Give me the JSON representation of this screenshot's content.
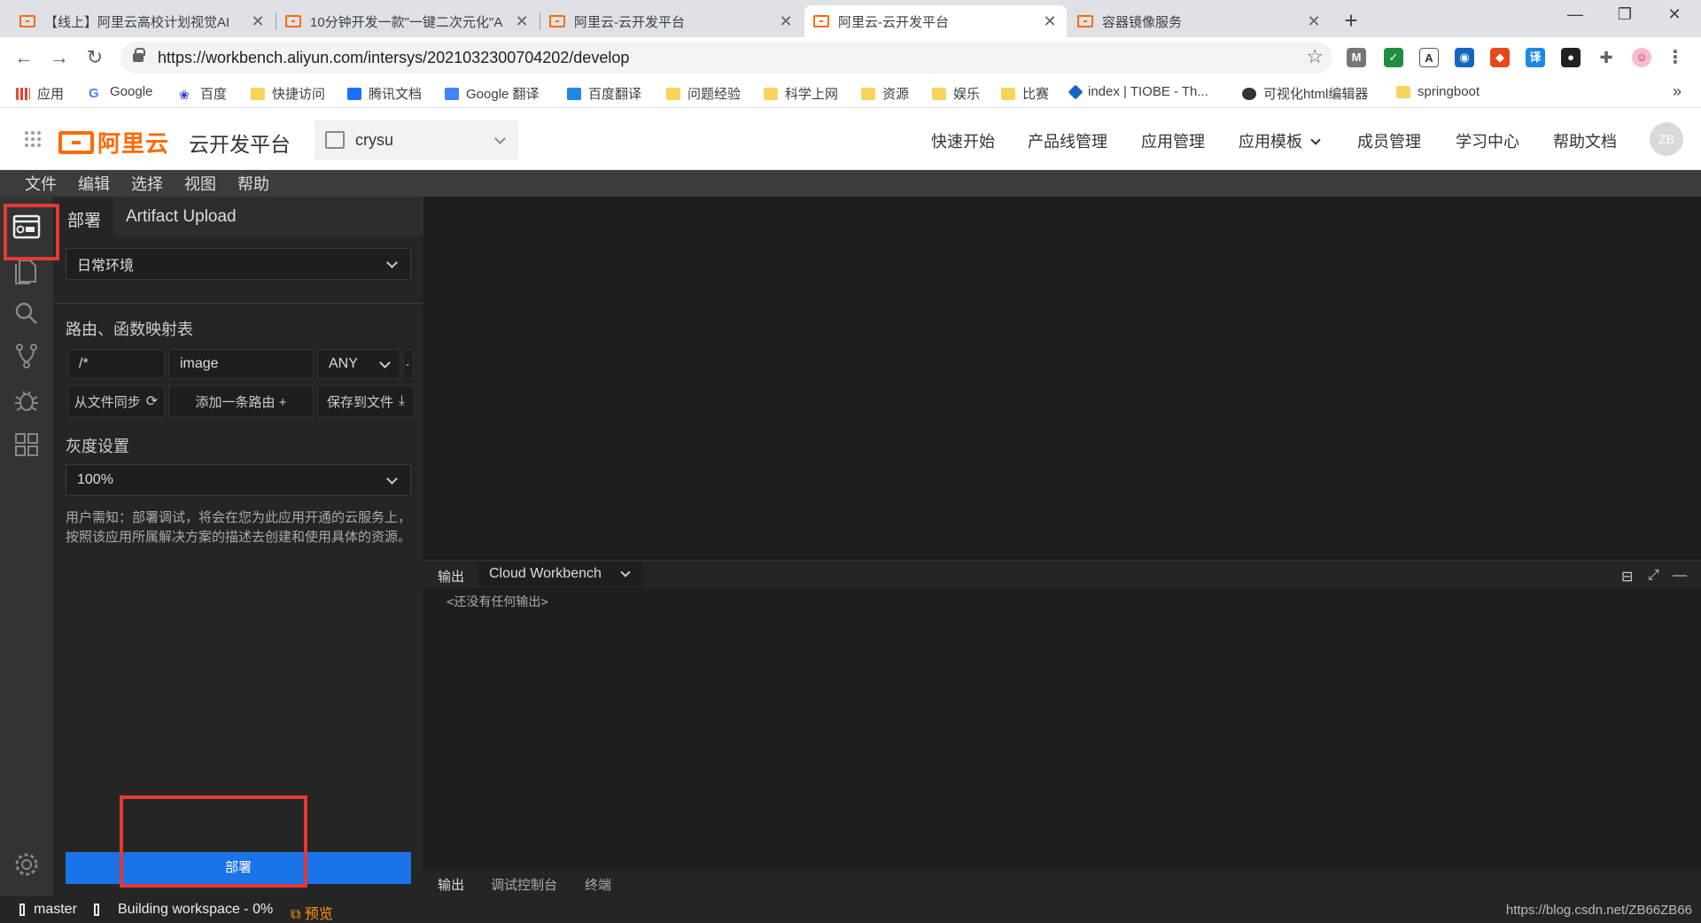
{
  "browser": {
    "tabs": [
      {
        "title": "【线上】阿里云高校计划视觉AI",
        "active": false
      },
      {
        "title": "10分钟开发一款\"一键二次元化\"A",
        "active": false
      },
      {
        "title": "阿里云-云开发平台",
        "active": false
      },
      {
        "title": "阿里云-云开发平台",
        "active": true
      },
      {
        "title": "容器镜像服务",
        "active": false
      }
    ],
    "url": "https://workbench.aliyun.com/intersys/2021032300704202/develop",
    "bookmarks": [
      {
        "label": "应用",
        "icon": "apps-icon"
      },
      {
        "label": "Google",
        "icon": "google-icon"
      },
      {
        "label": "百度",
        "icon": "baidu-icon"
      },
      {
        "label": "快捷访问",
        "icon": "folder-icon"
      },
      {
        "label": "腾讯文档",
        "icon": "tencent-docs-icon"
      },
      {
        "label": "Google 翻译",
        "icon": "google-translate-icon"
      },
      {
        "label": "百度翻译",
        "icon": "baidu-translate-icon"
      },
      {
        "label": "问题经验",
        "icon": "folder-icon"
      },
      {
        "label": "科学上网",
        "icon": "folder-icon"
      },
      {
        "label": "资源",
        "icon": "folder-icon"
      },
      {
        "label": "娱乐",
        "icon": "folder-icon"
      },
      {
        "label": "比赛",
        "icon": "folder-icon"
      },
      {
        "label": "index | TIOBE - Th...",
        "icon": "tiobe-icon"
      },
      {
        "label": "可视化html编辑器",
        "icon": "globe-icon"
      },
      {
        "label": "springboot",
        "icon": "folder-icon"
      }
    ],
    "bookmarks_more": "»"
  },
  "app": {
    "logo_text": "阿里云",
    "title": "云开发平台",
    "project": "crysu",
    "nav": [
      "快速开始",
      "产品线管理",
      "应用管理",
      "应用模板",
      "成员管理",
      "学习中心",
      "帮助文档"
    ],
    "avatar": "ZB"
  },
  "ide": {
    "menu": [
      "文件",
      "编辑",
      "选择",
      "视图",
      "帮助"
    ],
    "panel_tabs": [
      "部署",
      "Artifact Upload"
    ],
    "environment": "日常环境",
    "routes_title": "路由、函数映射表",
    "route": {
      "path": "/*",
      "target": "image",
      "method": "ANY",
      "remove": "-"
    },
    "sync_btn": "从文件同步",
    "add_route_btn": "添加一条路由 +",
    "save_btn": "保存到文件",
    "gray_title": "灰度设置",
    "gray_value": "100%",
    "notice": "用户需知：部署调试，将会在您为此应用开通的云服务上，按照该应用所属解决方案的描述去创建和使用具体的资源。",
    "deploy_btn": "部署",
    "output": {
      "label": "输出",
      "channel": "Cloud Workbench",
      "empty": "<还没有任何输出>"
    },
    "bottom_tabs": [
      "输出",
      "调试控制台",
      "终端"
    ],
    "status": {
      "branch": "master",
      "building": "Building workspace - 0%",
      "preview": "预览",
      "watermark": "https://blog.csdn.net/ZB66ZB66"
    }
  },
  "colors": {
    "accent": "#ff6a00",
    "deploy": "#1a73e8",
    "highlight": "#e53935"
  }
}
